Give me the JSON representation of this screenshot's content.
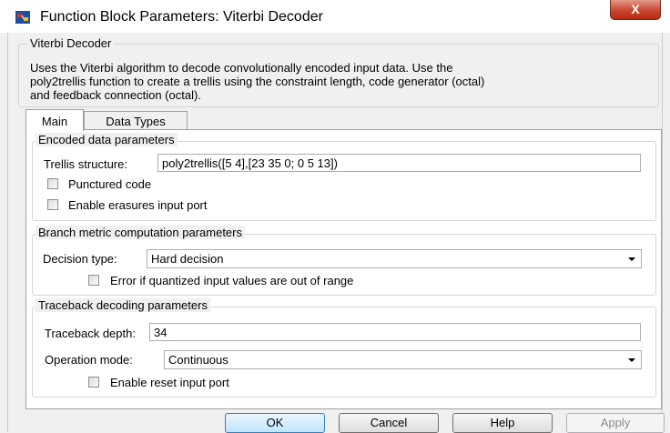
{
  "window": {
    "title": "Function Block Parameters: Viterbi Decoder",
    "close_label": "X"
  },
  "description": {
    "legend": "Viterbi Decoder",
    "lines": [
      "Uses the Viterbi algorithm to decode convolutionally encoded input data.  Use the",
      "poly2trellis function to create a trellis using the constraint length, code generator (octal)",
      "and feedback connection (octal)."
    ]
  },
  "tabs": [
    {
      "label": "Main",
      "active": true
    },
    {
      "label": "Data Types",
      "active": false
    }
  ],
  "encoded": {
    "legend": "Encoded data parameters",
    "trellis_label": "Trellis structure:",
    "trellis_value": "poly2trellis([5 4],[23 35 0; 0 5 13])",
    "punctured_label": "Punctured code",
    "punctured_checked": false,
    "erasures_label": "Enable erasures input port",
    "erasures_checked": false
  },
  "branch": {
    "legend": "Branch metric computation parameters",
    "decision_label": "Decision type:",
    "decision_value": "Hard decision",
    "error_label": "Error if quantized input values are out of range",
    "error_checked": false
  },
  "traceback": {
    "legend": "Traceback decoding parameters",
    "depth_label": "Traceback depth:",
    "depth_value": "34",
    "mode_label": "Operation mode:",
    "mode_value": "Continuous",
    "reset_label": "Enable reset input port",
    "reset_checked": false
  },
  "buttons": {
    "ok": "OK",
    "cancel": "Cancel",
    "help": "Help",
    "apply": "Apply"
  }
}
